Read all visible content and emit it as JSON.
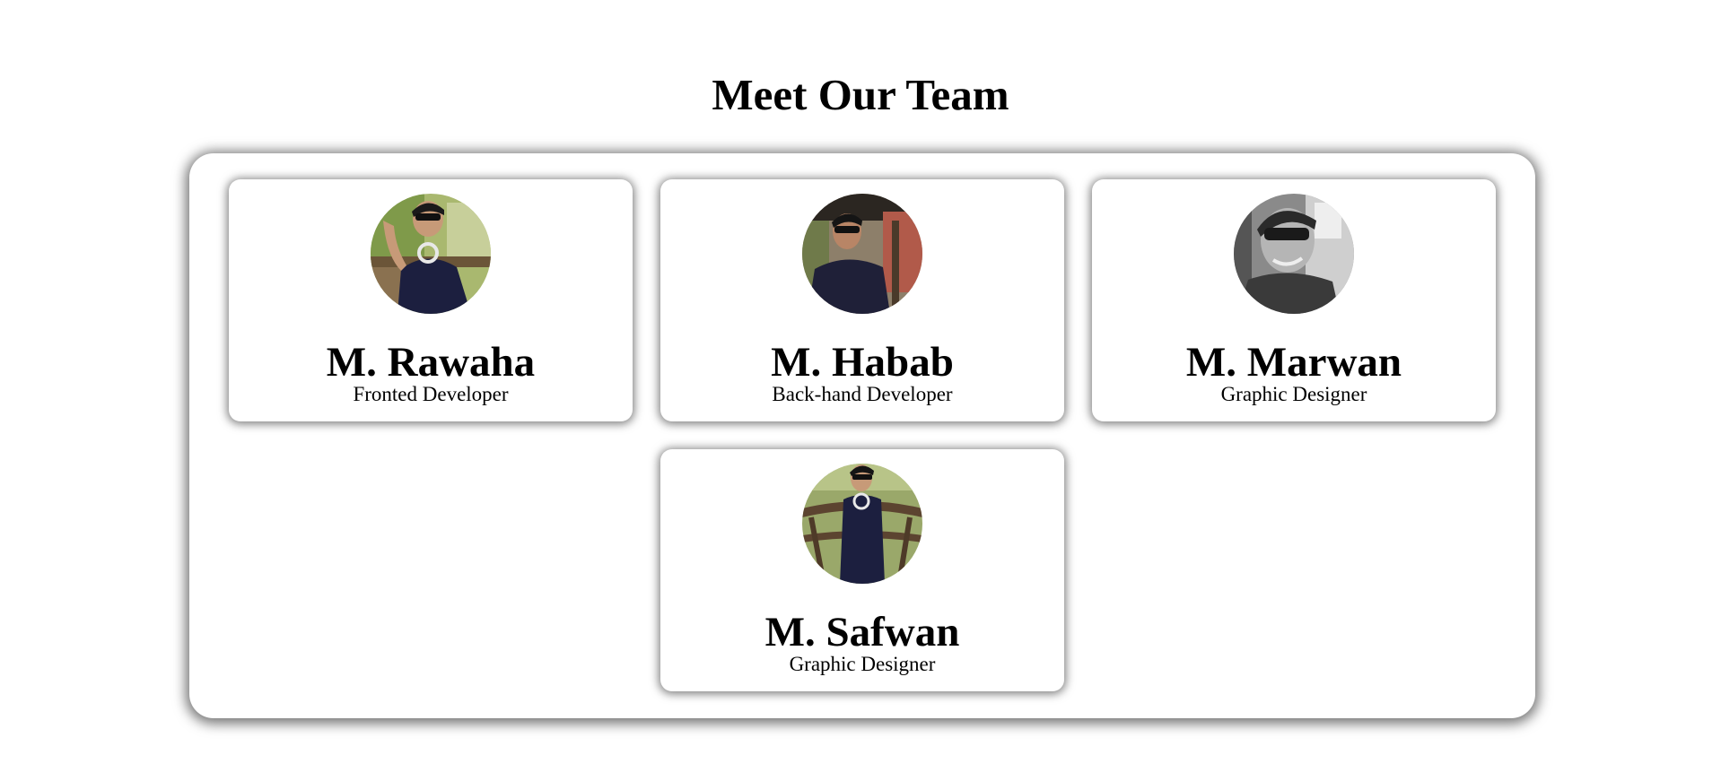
{
  "page": {
    "title": "Meet Our Team"
  },
  "team": [
    {
      "name": "M. Rawaha",
      "role": "Fronted Developer",
      "photo": "photo-rawaha",
      "grayscale": false
    },
    {
      "name": "M. Habab",
      "role": "Back-hand Developer",
      "photo": "photo-habab",
      "grayscale": false
    },
    {
      "name": "M. Marwan",
      "role": "Graphic Designer",
      "photo": "photo-marwan",
      "grayscale": true
    },
    {
      "name": "M. Safwan",
      "role": "Graphic Designer",
      "photo": "photo-safwan",
      "grayscale": false
    }
  ],
  "colors": {
    "background": "#ffffff",
    "text": "#000000",
    "shirt": "#1c1f3f",
    "foliage": "#8a9a55"
  }
}
